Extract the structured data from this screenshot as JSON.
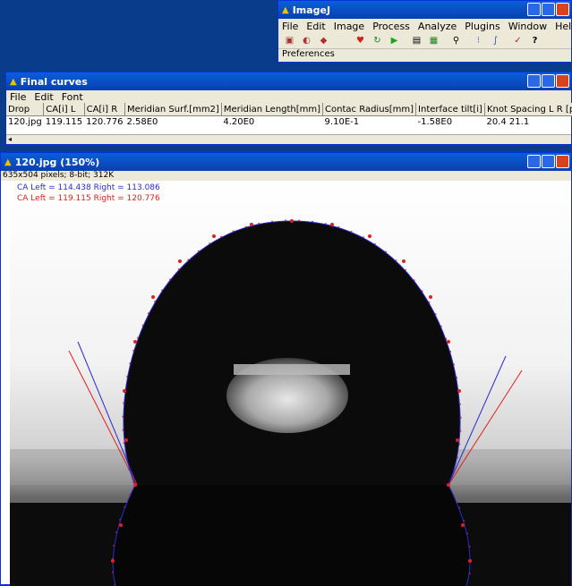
{
  "imagej": {
    "title": "ImageJ",
    "menu": [
      "File",
      "Edit",
      "Image",
      "Process",
      "Analyze",
      "Plugins",
      "Window",
      "Help"
    ],
    "status": "Preferences",
    "tools": [
      "rect-tool-icon",
      "oval-tool-icon",
      "polygon-tool-icon",
      "heart-icon",
      "refresh-icon",
      "play-icon",
      "document-icon",
      "table-icon",
      "zoom-icon",
      "list-icon",
      "curve-icon",
      "check-icon",
      "help-icon"
    ]
  },
  "curves": {
    "title": "Final curves",
    "menu": [
      "File",
      "Edit",
      "Font"
    ],
    "headers": [
      "Drop",
      "CA[i] L",
      "CA[i] R",
      "Meridian Surf.[mm2]",
      "Meridian Length[mm]",
      "Contac Radius[mm]",
      "Interface tilt[i]",
      "Knot Spacing L R [pix]"
    ],
    "row": [
      "120.jpg",
      "119.115",
      "120.776",
      "2.58E0",
      "4.20E0",
      "9.10E-1",
      "-1.58E0",
      "20.4 21.1"
    ]
  },
  "imgwin": {
    "title": "120.jpg (150%)",
    "info": "635x504 pixels; 8-bit; 312K",
    "ca_blue": "CA Left = 114.438 Right = 113.086",
    "ca_red": "CA Left = 119.115 Right = 120.776",
    "blue_color": "#2a2ad0",
    "red_color": "#e02020"
  }
}
